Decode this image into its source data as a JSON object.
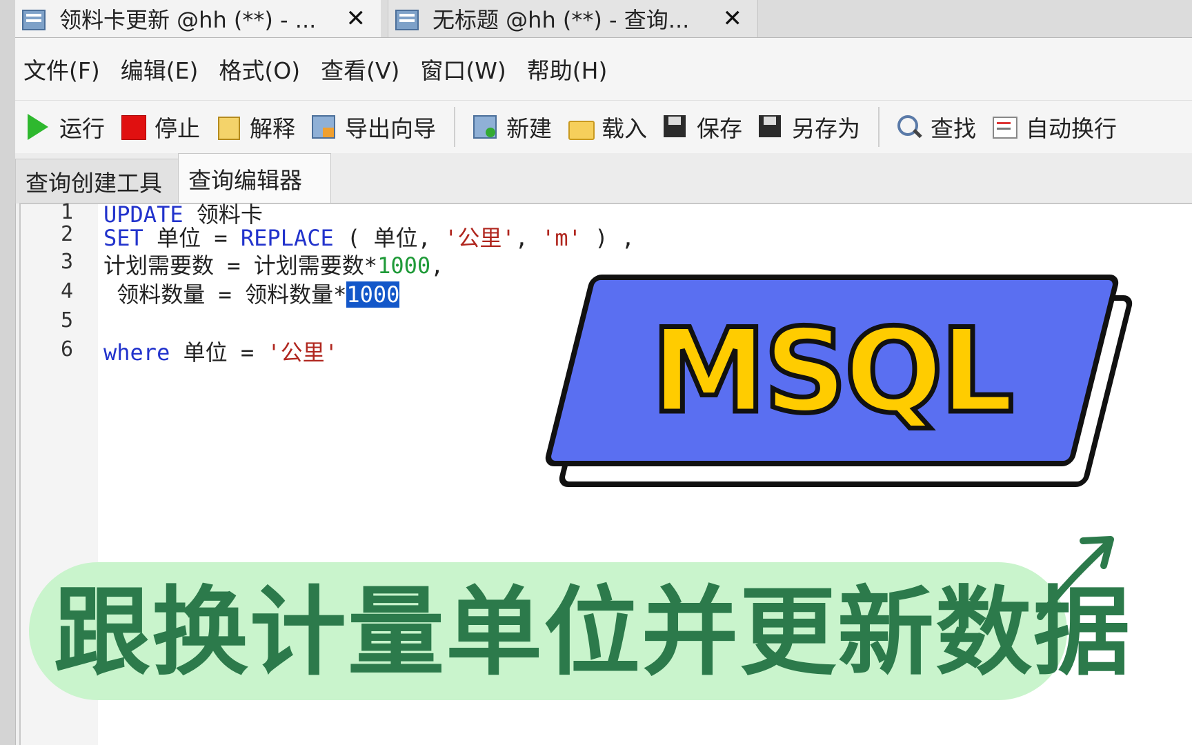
{
  "window_tabs": [
    {
      "label": "领料卡更新 @hh (**) - ...",
      "close": "✕"
    },
    {
      "label": "无标题 @hh (**) - 查询...",
      "close": "✕"
    }
  ],
  "menu": [
    "文件(F)",
    "编辑(E)",
    "格式(O)",
    "查看(V)",
    "窗口(W)",
    "帮助(H)"
  ],
  "toolbar": {
    "run": "运行",
    "stop": "停止",
    "explain": "解释",
    "export": "导出向导",
    "new": "新建",
    "load": "载入",
    "save": "保存",
    "save_as": "另存为",
    "find": "查找",
    "word_wrap": "自动换行"
  },
  "subtabs": [
    "查询创建工具",
    "查询编辑器"
  ],
  "editor": {
    "line_numbers": [
      "1",
      "2",
      "3",
      "4",
      "5",
      "6"
    ],
    "l1": {
      "kw": "UPDATE",
      "text": " 领料卡"
    },
    "l2": {
      "kw1": "SET",
      "t1": " 单位 = ",
      "kw2": "REPLACE",
      "t2": " ( 单位, ",
      "s1": "'公里'",
      "t3": ", ",
      "s2": "'m'",
      "t4": " ) ,"
    },
    "l3": {
      "t1": "计划需要数 = 计划需要数*",
      "num": "1000",
      "t2": ","
    },
    "l4": {
      "t1": " 领料数量 = 领料数量*",
      "sel": "1000"
    },
    "l6": {
      "kw": "where",
      "t1": " 单位 = ",
      "s1": "'公里'"
    }
  },
  "overlay": {
    "badge": "MSQL",
    "caption": "跟换计量单位并更新数据"
  },
  "colors": {
    "badge_fill": "#5a6ff1",
    "badge_text": "#ffcc00",
    "caption_text": "#2c7a4b",
    "caption_bg": "#c9f4cc",
    "keyword": "#2233cc",
    "string": "#b0261e",
    "number": "#1f9a38",
    "selection": "#1357c9"
  }
}
